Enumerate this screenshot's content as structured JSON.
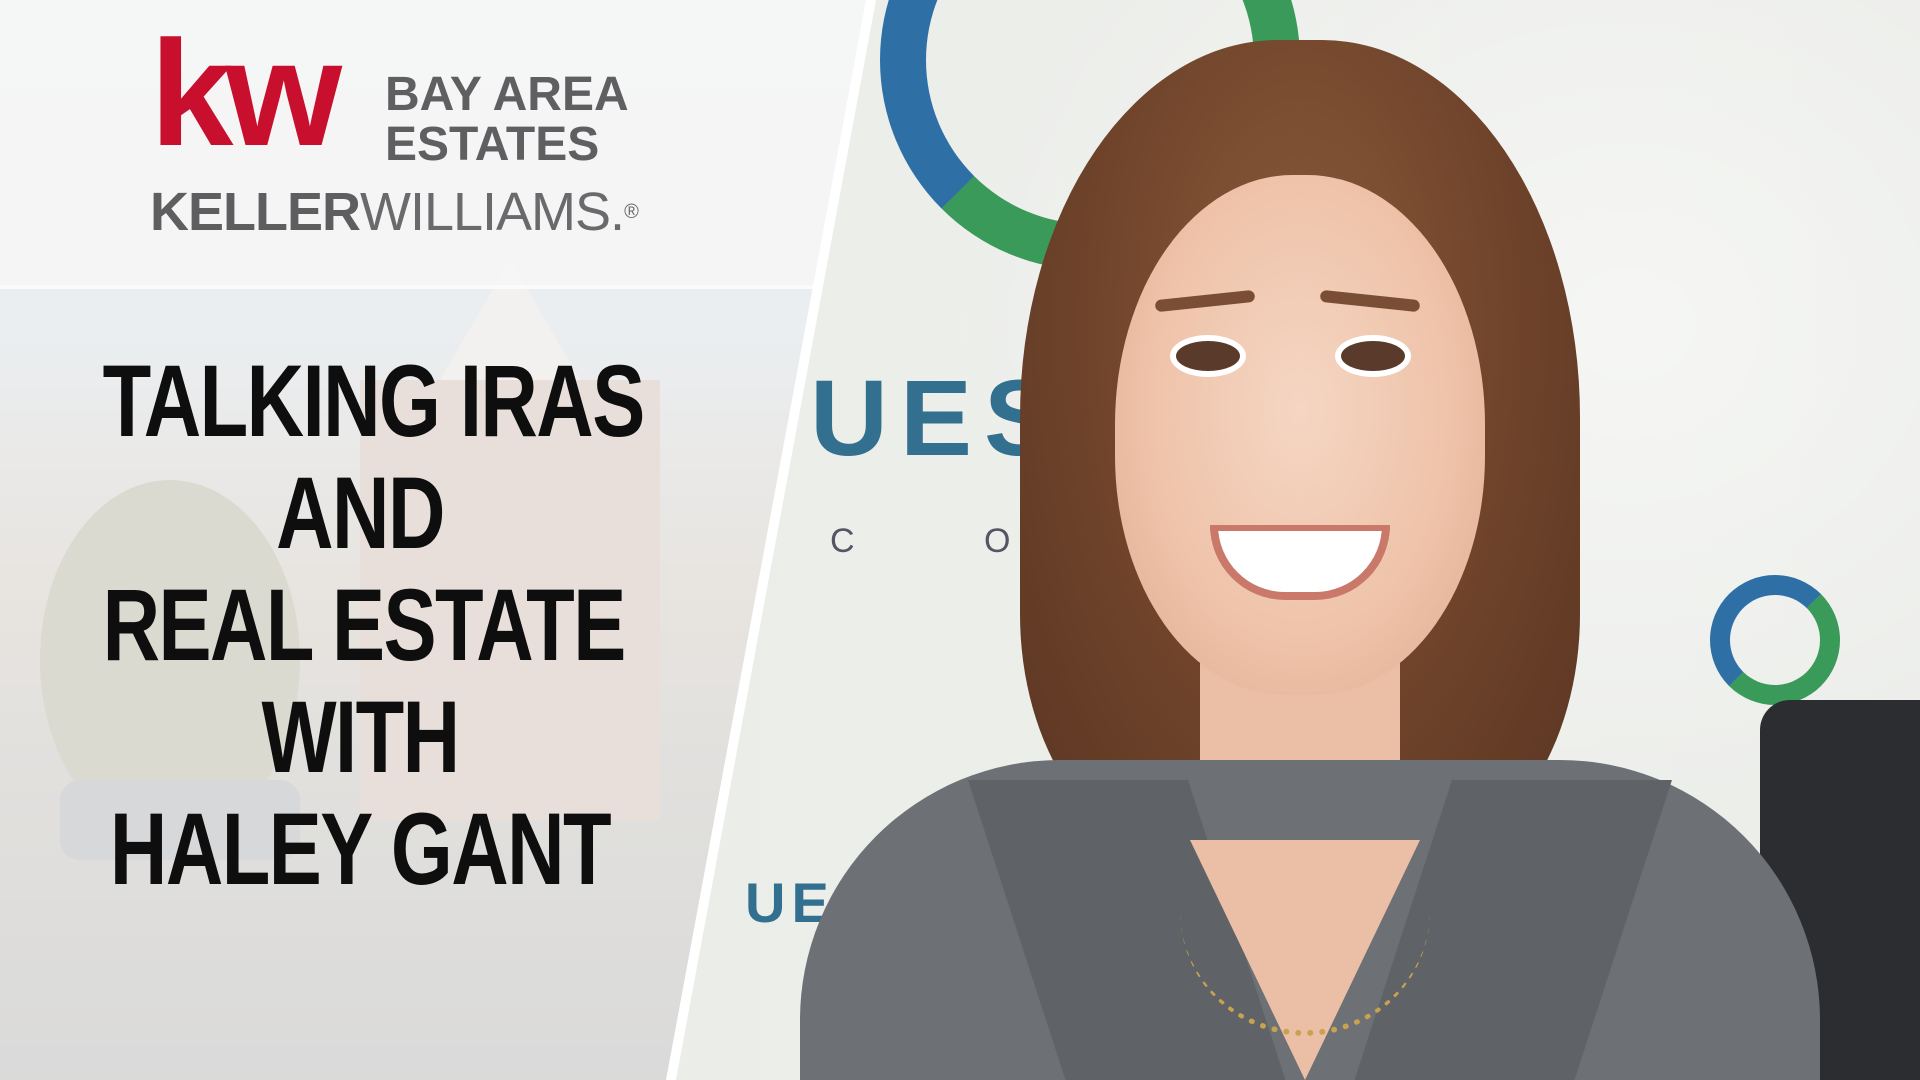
{
  "logo": {
    "mark": "kw",
    "line1": "BAY AREA",
    "line2": "ESTATES",
    "brand_bold": "KELLER",
    "brand_light": "WILLIAMS.",
    "registered": "®"
  },
  "headline": [
    "TALKING IRAS",
    "AND",
    "REAL ESTATE",
    "WITH",
    "HALEY GANT"
  ],
  "background": {
    "wall_text": "UES  ST",
    "wall_subtext": "C O",
    "wall_text_lower": "UES"
  },
  "colors": {
    "kw_red": "#c8102e",
    "logo_gray": "#5f5f62",
    "headline": "#0e0e0e",
    "wall_blue": "#2e6fa6",
    "wall_green": "#3a9a5a"
  }
}
